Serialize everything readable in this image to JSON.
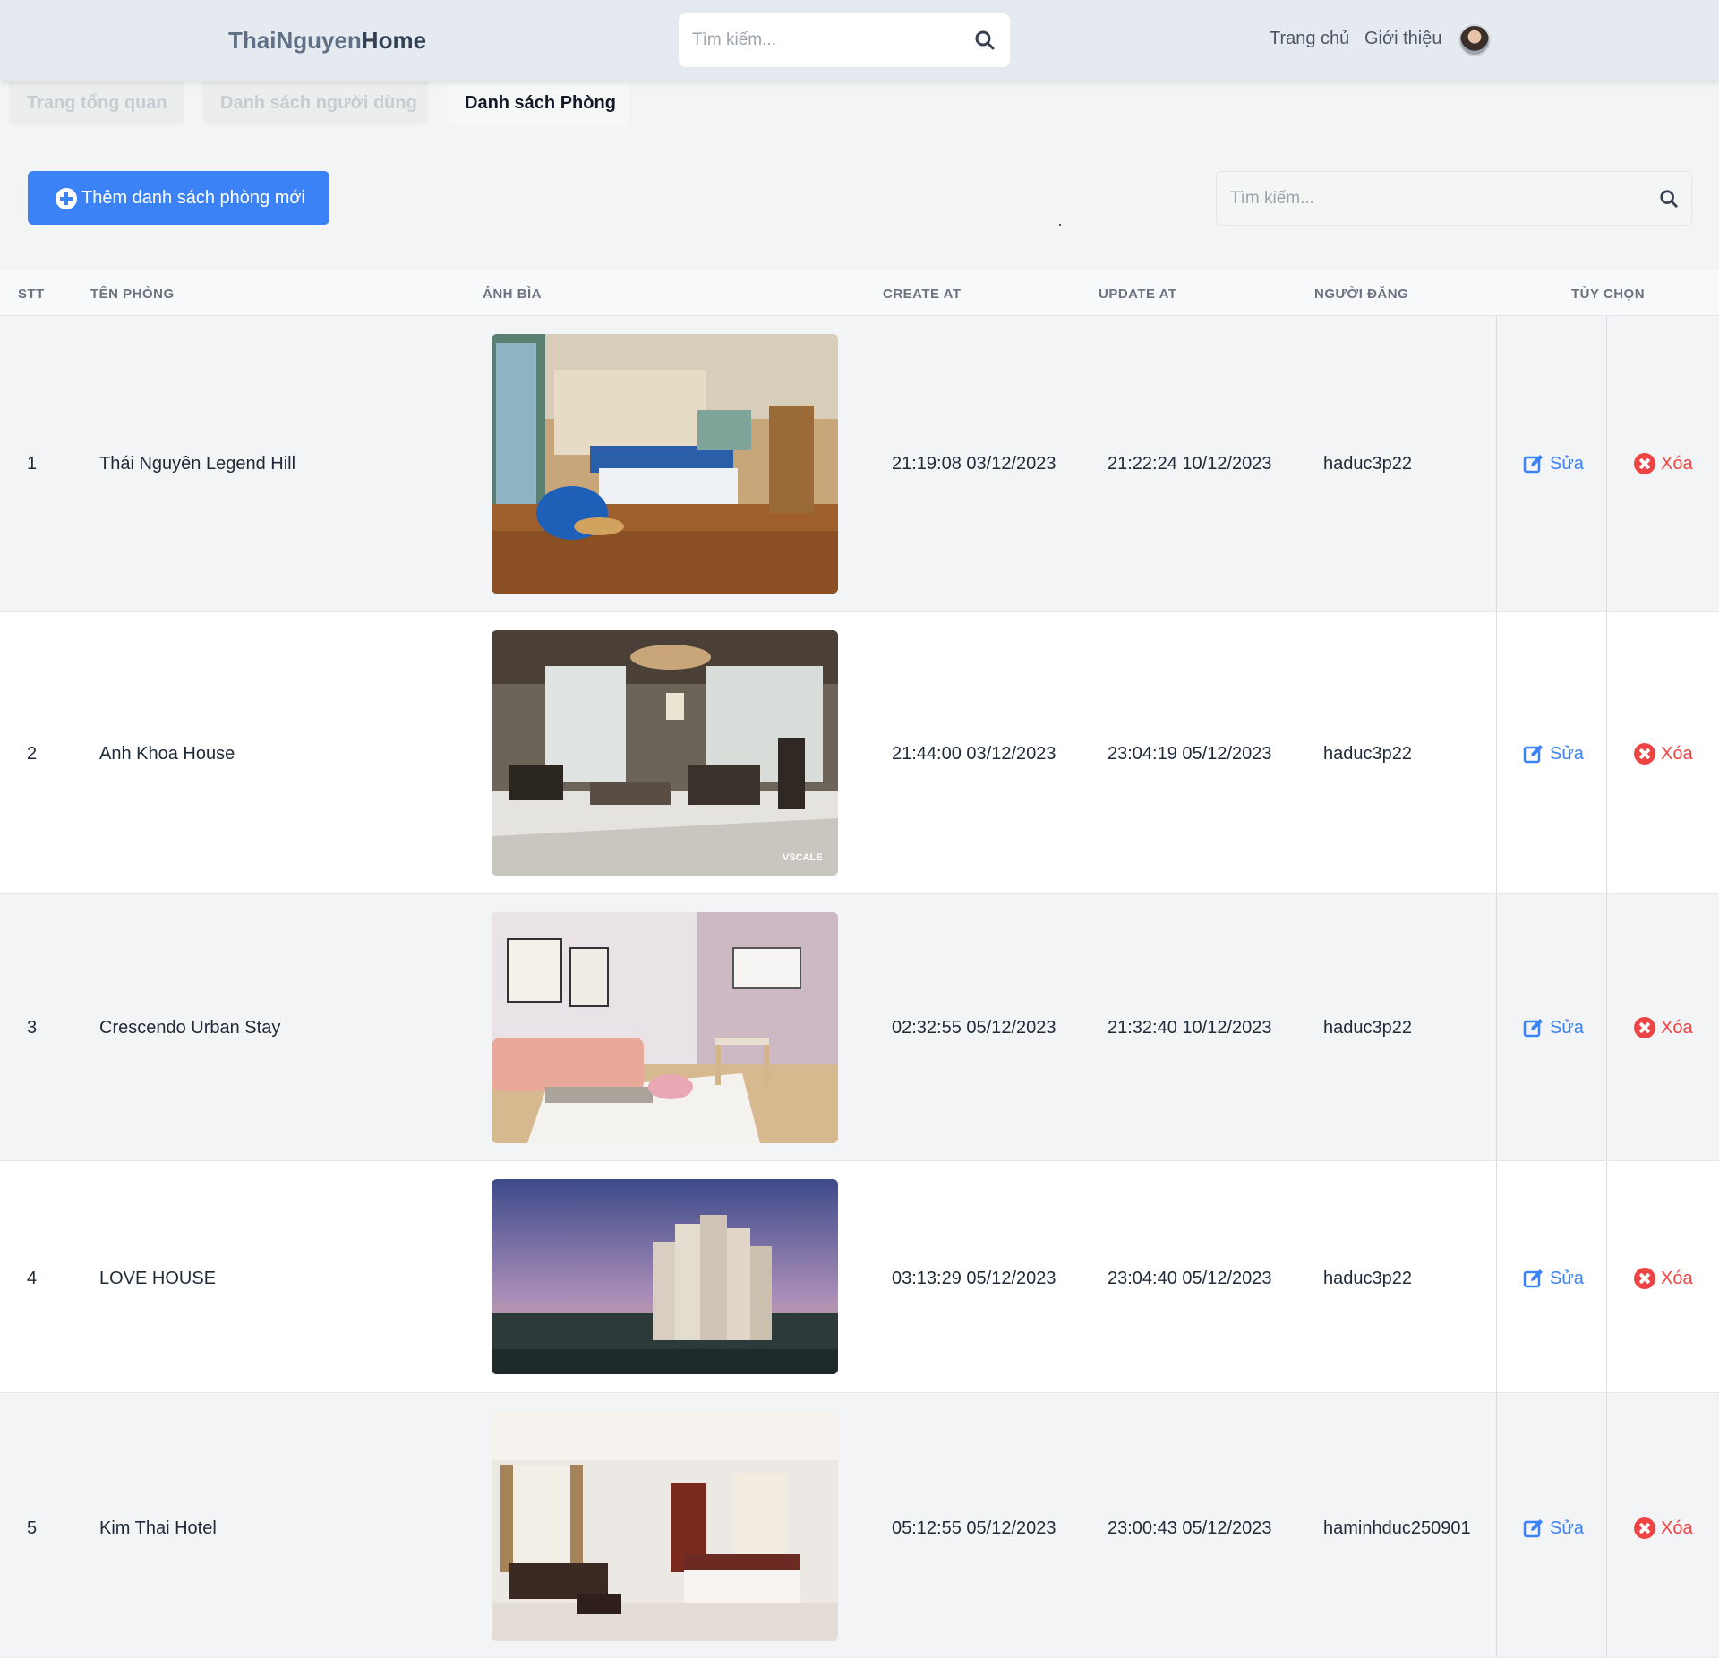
{
  "header": {
    "brand_part1": "ThaiNguyen",
    "brand_part2": "Home",
    "search_placeholder": "Tìm kiếm...",
    "nav": [
      "Trang chủ",
      "Giới thiệu"
    ]
  },
  "tabs": [
    {
      "label": "Trang tổng quan",
      "active": false
    },
    {
      "label": "Danh sách người dùng",
      "active": false
    },
    {
      "label": "Danh sách Phòng",
      "active": true
    }
  ],
  "toolbar": {
    "add_label": "Thêm danh sách phòng mới",
    "search_placeholder": "Tìm kiếm..."
  },
  "table": {
    "columns": [
      "STT",
      "TÊN PHÒNG",
      "ẢNH BÌA",
      "CREATE AT",
      "UPDATE AT",
      "NGƯỜI ĐĂNG",
      "TÙY CHỌN"
    ],
    "edit_label": "Sửa",
    "delete_label": "Xóa",
    "rows": [
      {
        "stt": "1",
        "name": "Thái Nguyên Legend Hill",
        "image": "hotel bedroom with blue armchairs",
        "created": "21:19:08 03/12/2023",
        "updated": "21:22:24 10/12/2023",
        "author": "haduc3p22"
      },
      {
        "stt": "2",
        "name": "Anh Khoa House",
        "image": "classic living room with chandelier",
        "created": "21:44:00 03/12/2023",
        "updated": "23:04:19 05/12/2023",
        "author": "haduc3p22"
      },
      {
        "stt": "3",
        "name": "Crescendo Urban Stay",
        "image": "pastel apartment living room",
        "created": "02:32:55 05/12/2023",
        "updated": "21:32:40 10/12/2023",
        "author": "haduc3p22"
      },
      {
        "stt": "4",
        "name": "LOVE HOUSE",
        "image": "high-rise towers at dusk",
        "created": "03:13:29 05/12/2023",
        "updated": "23:04:40 05/12/2023",
        "author": "haduc3p22"
      },
      {
        "stt": "5",
        "name": "Kim Thai Hotel",
        "image": "hotel suite with red furniture",
        "created": "05:12:55 05/12/2023",
        "updated": "23:00:43 05/12/2023",
        "author": "haminhduc250901"
      }
    ]
  },
  "colors": {
    "accent": "#3b82f6",
    "danger": "#ef4444"
  }
}
